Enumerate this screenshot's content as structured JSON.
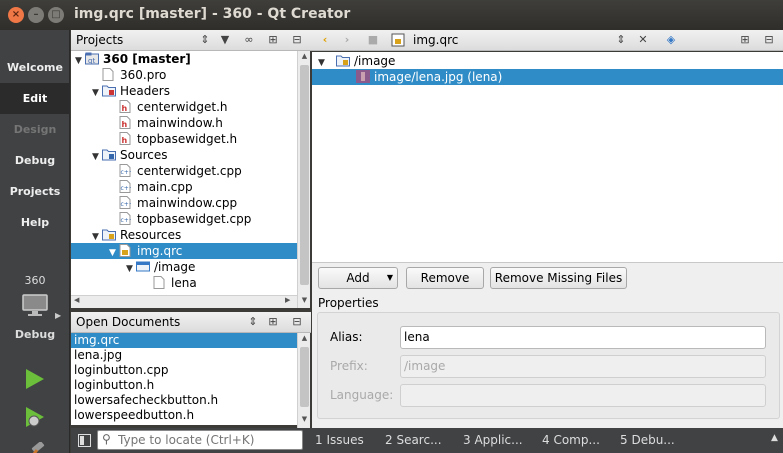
{
  "window": {
    "title": "img.qrc [master] - 360 - Qt Creator"
  },
  "modes": [
    "Welcome",
    "Edit",
    "Design",
    "Debug",
    "Projects",
    "Help"
  ],
  "kit": {
    "project": "360",
    "build": "Debug"
  },
  "projects_panel": {
    "title": "Projects",
    "tree": [
      {
        "label": "360 [master]",
        "depth": 0,
        "expanded": true,
        "icon": "project-icon",
        "bold": true
      },
      {
        "label": "360.pro",
        "depth": 1,
        "icon": "pro-file-icon"
      },
      {
        "label": "Headers",
        "depth": 1,
        "expanded": true,
        "icon": "headers-folder-icon"
      },
      {
        "label": "centerwidget.h",
        "depth": 2,
        "icon": "header-file-icon"
      },
      {
        "label": "mainwindow.h",
        "depth": 2,
        "icon": "header-file-icon"
      },
      {
        "label": "topbasewidget.h",
        "depth": 2,
        "icon": "header-file-icon"
      },
      {
        "label": "Sources",
        "depth": 1,
        "expanded": true,
        "icon": "sources-folder-icon"
      },
      {
        "label": "centerwidget.cpp",
        "depth": 2,
        "icon": "cpp-file-icon"
      },
      {
        "label": "main.cpp",
        "depth": 2,
        "icon": "cpp-file-icon"
      },
      {
        "label": "mainwindow.cpp",
        "depth": 2,
        "icon": "cpp-file-icon"
      },
      {
        "label": "topbasewidget.cpp",
        "depth": 2,
        "icon": "cpp-file-icon"
      },
      {
        "label": "Resources",
        "depth": 1,
        "expanded": true,
        "icon": "resources-folder-icon"
      },
      {
        "label": "img.qrc",
        "depth": 2,
        "expanded": true,
        "icon": "qrc-file-icon",
        "selected": true
      },
      {
        "label": "/image",
        "depth": 3,
        "expanded": true,
        "icon": "prefix-icon"
      },
      {
        "label": "lena",
        "depth": 4,
        "icon": "file-icon"
      }
    ]
  },
  "open_documents": {
    "title": "Open Documents",
    "items": [
      "img.qrc",
      "lena.jpg",
      "loginbutton.cpp",
      "loginbutton.h",
      "lowersafecheckbutton.h",
      "lowerspeedbutton.h"
    ],
    "selected_index": 0
  },
  "editor": {
    "file_name": "img.qrc",
    "resource_tree": [
      {
        "label": "/image",
        "depth": 0
      },
      {
        "label": "image/lena.jpg (lena)",
        "depth": 1,
        "selected": true
      }
    ],
    "buttons": {
      "add": "Add",
      "remove": "Remove",
      "remove_missing": "Remove Missing Files"
    },
    "properties": {
      "title": "Properties",
      "alias_label": "Alias:",
      "alias_value": "lena",
      "prefix_label": "Prefix:",
      "prefix_value": "/image",
      "language_label": "Language:",
      "language_value": ""
    }
  },
  "statusbar": {
    "locator_placeholder": "Type to locate (Ctrl+K)",
    "output_tabs": [
      "1  Issues",
      "2  Searc...",
      "3  Applic...",
      "4  Comp...",
      "5  Debu..."
    ]
  },
  "colors": {
    "selection": "#308cc6",
    "modebar": "#404244",
    "close": "#f07746"
  }
}
